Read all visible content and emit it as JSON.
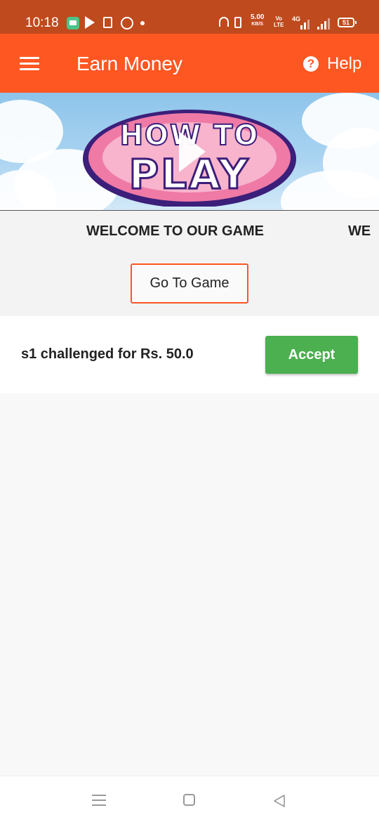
{
  "status_bar": {
    "time": "10:18",
    "network_speed": "5.00",
    "network_speed_unit": "KB/S",
    "volte_top": "Vo",
    "volte_bottom": "LTE",
    "network_type": "4G",
    "battery": "51",
    "notification_icons": [
      "messages-icon",
      "play-store-icon",
      "copy-icon",
      "whatsapp-icon",
      "dot-icon"
    ],
    "system_icons": [
      "headset-icon",
      "vibrate-icon",
      "signal-icon",
      "battery-icon"
    ]
  },
  "app_bar": {
    "title": "Earn Money",
    "help_label": "Help",
    "help_glyph": "?",
    "menu_icon": "hamburger-menu-icon",
    "background": "#fe5722"
  },
  "banner": {
    "logo_line1": "HOW TO",
    "logo_line2": "PLAY",
    "overlay_icon": "play-icon"
  },
  "welcome": {
    "marquee_text": "WELCOME TO OUR GAME",
    "marquee_text_repeat": "WE",
    "go_button_label": "Go To Game"
  },
  "challenges": [
    {
      "text": "s1 challenged for Rs. 50.0",
      "action_label": "Accept"
    }
  ],
  "nav_bar": {
    "buttons": [
      "recent-apps-icon",
      "home-icon",
      "back-icon"
    ]
  },
  "colors": {
    "status_bar": "#bf4a1d",
    "accent": "#fe5722",
    "accept": "#4caf50"
  }
}
